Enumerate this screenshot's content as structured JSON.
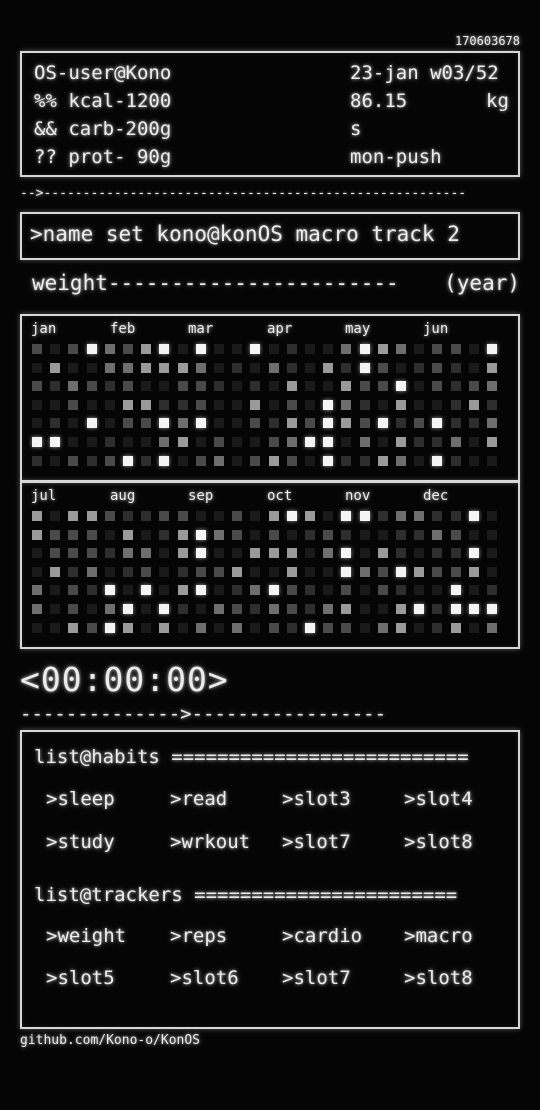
{
  "timestamp": "170603678",
  "header": {
    "user": "OS-user@Kono",
    "kcal": "%% kcal-1200",
    "carb": "&& carb-200g",
    "prot": "?? prot- 90g",
    "date": "23-jan w03/52",
    "weight_value": "86.15",
    "weight_unit": "kg",
    "unit_small": "s",
    "routine": "mon-push"
  },
  "divider1": "-->------------------------------------------------------",
  "command": ">name set kono@konOS macro track 2",
  "weight_section": {
    "title": "weight-----------------------",
    "period": "(year)",
    "months_top": [
      "jan",
      "feb",
      "mar",
      "apr",
      "may",
      "jun"
    ],
    "months_bottom": [
      "jul",
      "aug",
      "sep",
      "oct",
      "nov",
      "dec"
    ]
  },
  "timer": "<00:00:00>",
  "divider2": "-------------->-----------------",
  "habits": {
    "title": "list@habits ==========================",
    "items": [
      ">sleep",
      ">read",
      ">slot3",
      ">slot4",
      ">study",
      ">wrkout",
      ">slot7",
      ">slot8"
    ]
  },
  "trackers": {
    "title": "list@trackers =======================",
    "items": [
      ">weight",
      ">reps",
      ">cardio",
      ">macro",
      ">slot5",
      ">slot6",
      ">slot7",
      ">slot8"
    ]
  },
  "footer": "github.com/Kono-o/KonOS"
}
